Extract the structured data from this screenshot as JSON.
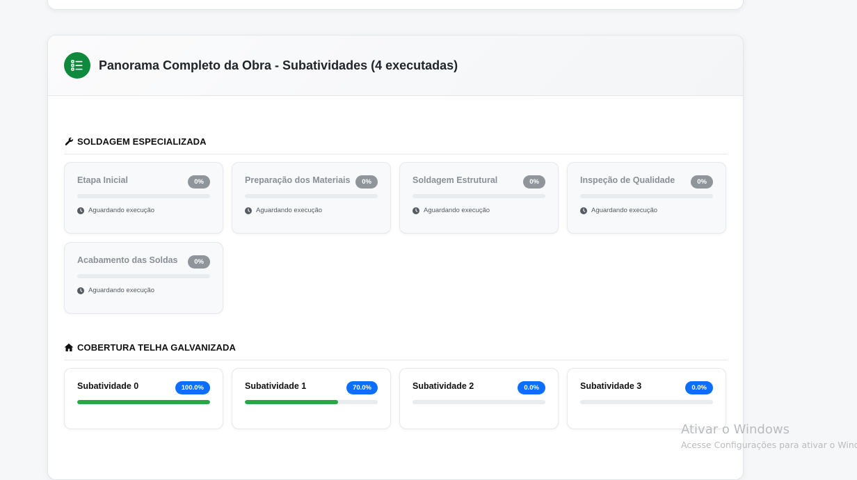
{
  "header": {
    "title": "Panorama Completo da Obra - Subatividades (4 executadas)",
    "icon": "task-list-icon",
    "icon_bg": "#0f8a3c"
  },
  "sections": [
    {
      "title": "SOLDAGEM ESPECIALIZADA",
      "icon": "wrench-icon",
      "items": [
        {
          "name": "Etapa Inicial",
          "progress_label": "0%",
          "progress": 0,
          "status": "Aguardando execução"
        },
        {
          "name": "Preparação dos Materiais",
          "progress_label": "0%",
          "progress": 0,
          "status": "Aguardando execução"
        },
        {
          "name": "Soldagem Estrutural",
          "progress_label": "0%",
          "progress": 0,
          "status": "Aguardando execução"
        },
        {
          "name": "Inspeção de Qualidade",
          "progress_label": "0%",
          "progress": 0,
          "status": "Aguardando execução"
        },
        {
          "name": "Acabamento das Soldas",
          "progress_label": "0%",
          "progress": 0,
          "status": "Aguardando execução"
        }
      ]
    },
    {
      "title": "COBERTURA TELHA GALVANIZADA",
      "icon": "home-icon",
      "items": [
        {
          "name": "Subatividade 0",
          "progress_label": "100.0%",
          "progress": 100
        },
        {
          "name": "Subatividade 1",
          "progress_label": "70.0%",
          "progress": 70
        },
        {
          "name": "Subatividade 2",
          "progress_label": "0.0%",
          "progress": 0
        },
        {
          "name": "Subatividade 3",
          "progress_label": "0.0%",
          "progress": 0
        }
      ]
    }
  ],
  "colors": {
    "progress_fill": "#28a745",
    "badge_active": "#0d6efd",
    "badge_pending": "#8f959b"
  },
  "watermark": {
    "line1": "Ativar o Windows",
    "line2": "Acesse Configurações para ativar o Windows."
  }
}
